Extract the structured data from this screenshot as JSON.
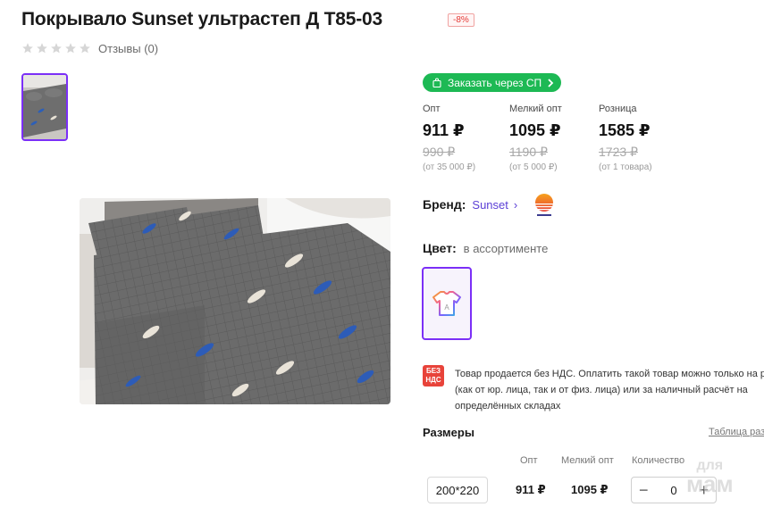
{
  "product": {
    "title": "Покрывало Sunset ультрастеп Д Т85-03",
    "discount_badge": "-8%",
    "reviews_label": "Отзывы (0)",
    "rating_stars": 0
  },
  "order_button": {
    "label": "Заказать через СП",
    "color": "#1db954"
  },
  "prices": [
    {
      "label": "Опт",
      "price": "911 ₽",
      "old_price": "990 ₽",
      "note": "(от 35 000 ₽)"
    },
    {
      "label": "Мелкий опт",
      "price": "1095 ₽",
      "old_price": "1190 ₽",
      "note": "(от 5 000 ₽)"
    },
    {
      "label": "Розница",
      "price": "1585 ₽",
      "old_price": "1723 ₽",
      "note": "(от 1 товара)"
    }
  ],
  "brand": {
    "label": "Бренд:",
    "name": "Sunset",
    "logo_icon": "sunset-logo-icon"
  },
  "color": {
    "label": "Цвет:",
    "value": "в ассортименте",
    "swatch_icon": "tshirt-assorted-icon",
    "swatch_letter": "A"
  },
  "nds": {
    "badge_top": "БЕЗ",
    "badge_bottom": "НДС",
    "text": "Товар продается без НДС. Оплатить такой товар можно только на р (как от юр. лица, так и от физ. лица) или за наличный расчёт на определённых складах"
  },
  "sizes": {
    "title": "Размеры",
    "table_link": "Таблица раз",
    "headers": {
      "wholesale": "Опт",
      "small_wholesale": "Мелкий опт",
      "quantity": "Количество"
    },
    "rows": [
      {
        "size": "200*220",
        "wholesale": "911 ₽",
        "small_wholesale": "1095 ₽",
        "quantity": "0"
      }
    ]
  },
  "watermark": {
    "top": "для",
    "bottom": "мам"
  },
  "colors": {
    "accent": "#7b2ff7",
    "link": "#5b3fd6",
    "badge_red": "#e8433a",
    "discount_red": "#e53935"
  }
}
